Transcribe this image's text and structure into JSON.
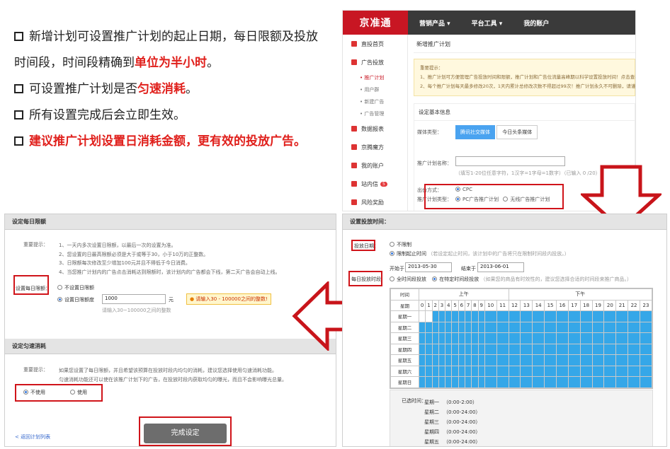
{
  "bullets": {
    "b1_pre": "新增计划可设置推广计划的起止日期，每日限额及投放时间段，时间段精确到",
    "b1_red": "单位为半小时",
    "b1_post": "。",
    "b2_pre": "可设置推广计划是否",
    "b2_red": "匀速消耗",
    "b2_post": "。",
    "b3": "所有设置完成后会立即生效。",
    "b4": "建议推广计划设置日消耗金额，更有效的投放广告。"
  },
  "jd": {
    "logo": "京准通",
    "nav": [
      "营销产品 ▾",
      "平台工具 ▾",
      "我的账户"
    ],
    "side": [
      {
        "label": "直投首页"
      },
      {
        "label": "广告投放"
      }
    ],
    "side_subs": [
      "• 推广计划",
      "• 用户群",
      "• 新建广告",
      "• 广告管理"
    ],
    "side2": [
      {
        "label": "数据报表"
      },
      {
        "label": "京腾魔方"
      },
      {
        "label": "我的账户"
      },
      {
        "label": "站内信",
        "badge": "5"
      },
      {
        "label": "风险奖励"
      }
    ],
    "page_title": "新增推广计划",
    "notice_title": "重要提示：",
    "notice_1": "1、推广计划可方便管理广告投放时间和限额，推广计划和广告位流量高峰期以科学设置投放时间！点击查看",
    "notice_2": "2、每个推广计划每天最多修改20次，1天内累计总修改次数不得超过99次！推广计划永久不可删除，请谨慎",
    "basic_info": "设定基本信息",
    "media_label": "媒体类型：",
    "media_btn1": "腾讯社交媒体",
    "media_btn2": "今日头条媒体",
    "name_label": "推广计划名称：",
    "name_hint": "（填写1-20位任意字符，1汉字=1字母=1数字）（已输入 0 /20）",
    "bid_label": "出价方式：",
    "bid_value": "CPC",
    "type_label": "推广计划类型：",
    "type_opt1": "PC广告推广计划",
    "type_opt2": "无线广告推广计划"
  },
  "left_panel": {
    "sec1_title": "设定每日限额",
    "tip_label": "重要提示：",
    "tips": [
      "1、一天内多次设置日限额，以最后一次的设置为准。",
      "2、您设置的日最高限额必须是大于或等于30，小于10万的正整数。",
      "3、日限额每次修改至少增加100元并且不得低于今日消费。",
      "4、当您推广计划内的广告点击消耗达到限额时，该计划内的广告都会下线，第二天广告会自动上线。"
    ],
    "limit_label": "设置每日限额：",
    "opt_none": "不设置日限额",
    "opt_set": "设置日限额度",
    "limit_value": "1000",
    "unit": "元",
    "warn_text": "请输入30 - 100000之间的整数!",
    "hint": "请输入30~100000之间的整数",
    "sec2_title": "设定匀速消耗",
    "tip2": "如果您设置了每日限额，并且希望该预算在投放时段内均匀的消耗，建议您选择使用匀速消耗功能。",
    "tip2b": "匀速消耗功能还可以使在该推广计划下的广告，在投放时段内获取均匀的曝光，而且不会影响曝光总量。",
    "opt_no": "不使用",
    "opt_yes": "使用",
    "back_link": "< 返回计划列表",
    "done_btn": "完成设定"
  },
  "right_panel": {
    "title": "设置投放时间：",
    "date_label": "投放日期：",
    "opt_unlimited": "不限制",
    "opt_range": "限制起止时间",
    "range_hint": "（若设定起止时间，该计划中的广告将只在限制时间段内投放。）",
    "start_label": "开始于",
    "start_value": "2013-05-30",
    "end_label": "结束于",
    "end_value": "2013-06-01",
    "slot_label": "每日投放时段",
    "opt_all": "全时间段投放",
    "opt_specific": "在特定时间段投放",
    "slot_hint": "（如果您的商品有时效性的，建议您选择合适的时间段来推广商品。）",
    "grid_time": "时间",
    "grid_am": "上午",
    "grid_pm": "下午",
    "grid_week": "星期",
    "hours": [
      "0",
      "1",
      "2",
      "3",
      "4",
      "5",
      "6",
      "7",
      "8",
      "9",
      "10",
      "11",
      "12",
      "13",
      "14",
      "15",
      "16",
      "17",
      "18",
      "19",
      "20",
      "21",
      "22",
      "23"
    ],
    "days": [
      "星期一",
      "星期二",
      "星期三",
      "星期四",
      "星期五",
      "星期六",
      "星期日"
    ],
    "selected_label": "已选时间：",
    "selected": [
      {
        "day": "星期一",
        "time": "（0:00-2:00）"
      },
      {
        "day": "星期二",
        "time": "（0:00-24:00）"
      },
      {
        "day": "星期三",
        "time": "（0:00-24:00）"
      },
      {
        "day": "星期四",
        "time": "（0:00-24:00）"
      },
      {
        "day": "星期五",
        "time": "（0:00-24:00）"
      },
      {
        "day": "星期六",
        "time": "（0:00-24:00）"
      }
    ]
  }
}
